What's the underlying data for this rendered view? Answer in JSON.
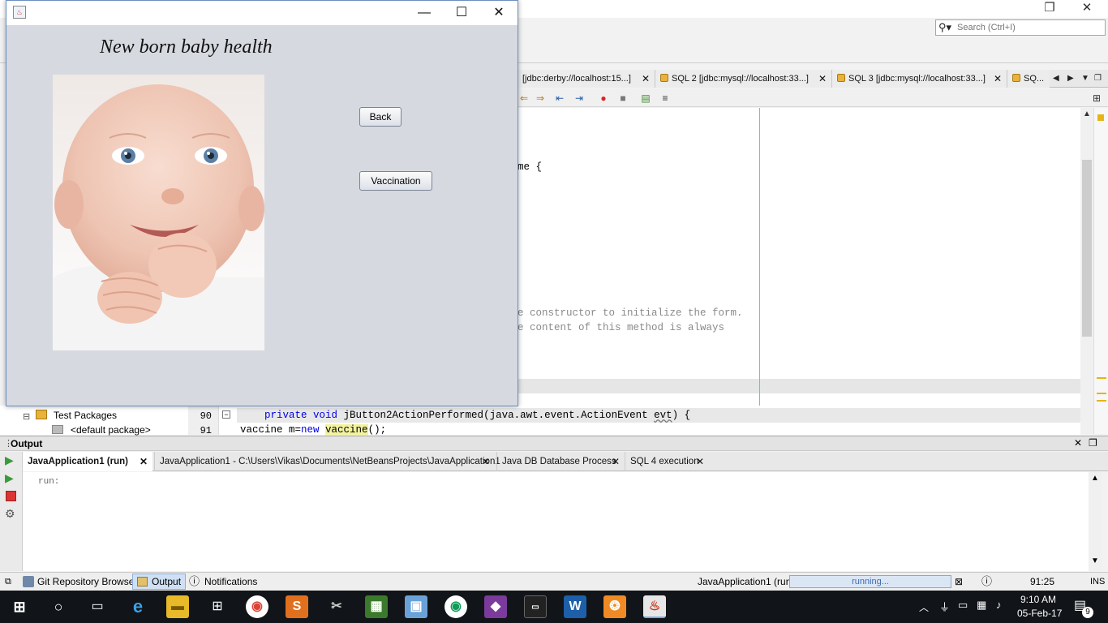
{
  "app_window": {
    "heading": "New born baby health",
    "back_label": "Back",
    "vaccination_label": "Vaccination",
    "image_alt": "baby-photo"
  },
  "ide": {
    "search_placeholder": "Search (Ctrl+I)",
    "sql_tabs": [
      {
        "label": "[jdbc:derby://localhost:15...]"
      },
      {
        "label": "SQL 2 [jdbc:mysql://localhost:33...]"
      },
      {
        "label": "SQL 3 [jdbc:mysql://localhost:33...]"
      },
      {
        "label": "SQ..."
      }
    ],
    "editor_lines": {
      "line_a": "me {",
      "line_b": "e constructor to initialize the form.",
      "line_c": "e content of this method is always"
    },
    "project_tree": {
      "test_packages": "Test Packages",
      "default_package": "<default package>"
    },
    "line_numbers": [
      "90",
      "91"
    ],
    "code_90_pre": "    private void ",
    "code_90_method": "jButton2ActionPerformed",
    "code_90_args": "(java.awt.event.ActionEvent ",
    "code_90_evt": "evt",
    "code_90_post": ") {",
    "code_91_pre": "vaccine m=",
    "code_91_new": "new",
    "code_91_space": " ",
    "code_91_class": "vaccine",
    "code_91_post": "();",
    "output": {
      "title": "Output",
      "tabs": [
        {
          "label": "JavaApplication1 (run)"
        },
        {
          "label": "JavaApplication1 - C:\\Users\\Vikas\\Documents\\NetBeansProjects\\JavaApplication1"
        },
        {
          "label": "Java DB Database Process"
        },
        {
          "label": "SQL 4 execution"
        }
      ],
      "body": "run:"
    },
    "statusbar": {
      "git": "Git Repository Browser",
      "output": "Output",
      "notifications": "Notifications",
      "project": "JavaApplication1 (run)",
      "progress": "running...",
      "position": "91:25",
      "mode": "INS"
    }
  },
  "taskbar": {
    "time": "9:10 AM",
    "date": "05-Feb-17",
    "notification_count": "9"
  },
  "colors": {
    "app_bg": "#d6d9e0",
    "accent": "#6e8fc0",
    "keyword": "#0000e6"
  }
}
